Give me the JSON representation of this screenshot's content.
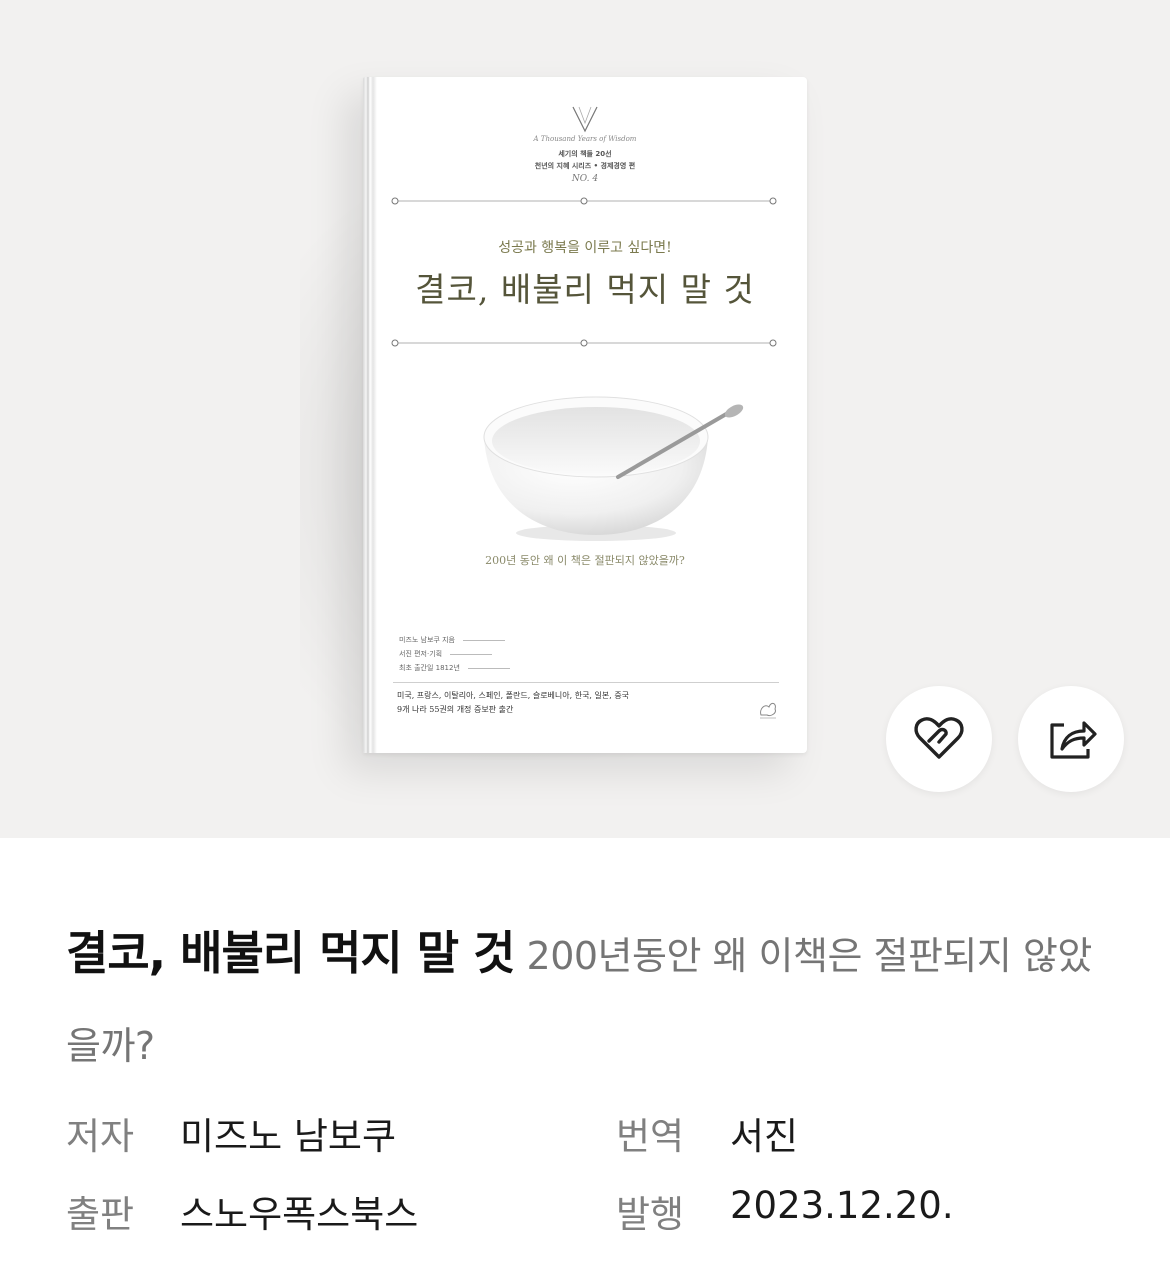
{
  "cover": {
    "script_line": "A Thousand Years of Wisdom",
    "series_line1": "세기의 책들 20선",
    "series_line2": "천년의 지혜 시리즈 • 경제경영 편",
    "series_no": "NO. 4",
    "kicker": "성공과 행복을 이루고 싶다면!",
    "title": "결코, 배불리 먹지 말 것",
    "question": "200년 동안 왜 이 책은 절판되지 않았을까?",
    "credits": [
      "미즈노 남보쿠 지음",
      "서진 편저·기획",
      "최초 출간일 1812년"
    ],
    "countries_line1": "미국, 프랑스, 이탈리아, 스페인, 폴란드, 슬로베니아, 한국, 일본, 중국",
    "countries_line2": "9개 나라 55권의 개정 증보판 출간"
  },
  "actions": {
    "like_icon": "heart-icon",
    "share_icon": "share-icon"
  },
  "book": {
    "title": "결코, 배불리 먹지 말 것",
    "subtitle": "200년동안 왜 이책은 절판되지 않았을까?",
    "meta": {
      "author_label": "저자",
      "author": "미즈노 남보쿠",
      "translator_label": "번역",
      "translator": "서진",
      "publisher_label": "출판",
      "publisher": "스노우폭스북스",
      "date_label": "발행",
      "date": "2023.12.20."
    }
  }
}
